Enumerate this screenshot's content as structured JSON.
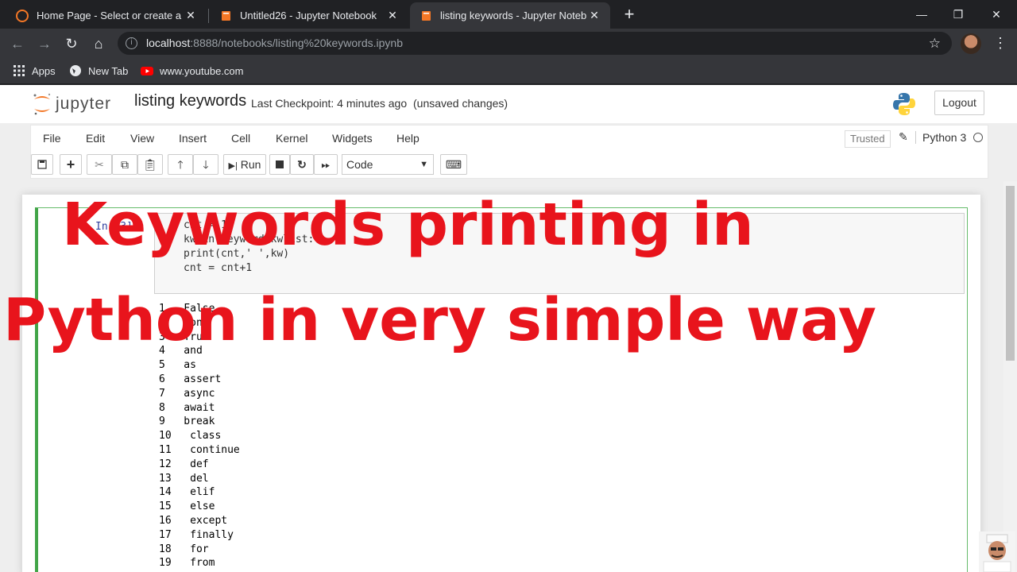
{
  "browser": {
    "tabs": [
      {
        "title": "Home Page - Select or create a n",
        "icon": "jupyter-logo-icon",
        "active": false
      },
      {
        "title": "Untitled26 - Jupyter Notebook",
        "icon": "notebook-icon",
        "active": false
      },
      {
        "title": "listing keywords - Jupyter Notebo",
        "icon": "notebook-icon",
        "active": true
      }
    ],
    "url_host": "localhost",
    "url_path": ":8888/notebooks/listing%20keywords.ipynb",
    "bookmarks": [
      "Apps",
      "New Tab",
      "www.youtube.com"
    ]
  },
  "jupyter": {
    "logo_text": "jupyter",
    "notebook_name": "listing keywords",
    "checkpoint": "Last Checkpoint: 4 minutes ago",
    "unsaved": "(unsaved changes)",
    "logout": "Logout",
    "menu": [
      "File",
      "Edit",
      "View",
      "Insert",
      "Cell",
      "Kernel",
      "Widgets",
      "Help"
    ],
    "trusted": "Trusted",
    "kernel_name": "Python 3",
    "run_label": "Run",
    "cell_type": "Code"
  },
  "cell": {
    "prompt": "In [3]:",
    "code_lines": [
      "cnt = 1",
      "kw in keyword.kwlist:",
      "print(cnt,' ',kw)",
      "cnt = cnt+1"
    ],
    "output": [
      "1   False",
      "2   None",
      "3   True",
      "4   and",
      "5   as",
      "6   assert",
      "7   async",
      "8   await",
      "9   break",
      "10   class",
      "11   continue",
      "12   def",
      "13   del",
      "14   elif",
      "15   else",
      "16   except",
      "17   finally",
      "18   for",
      "19   from"
    ]
  },
  "overlay": {
    "line1": "Keywords printing in",
    "line2": "Python in very simple way",
    "color": "#e8141c"
  }
}
